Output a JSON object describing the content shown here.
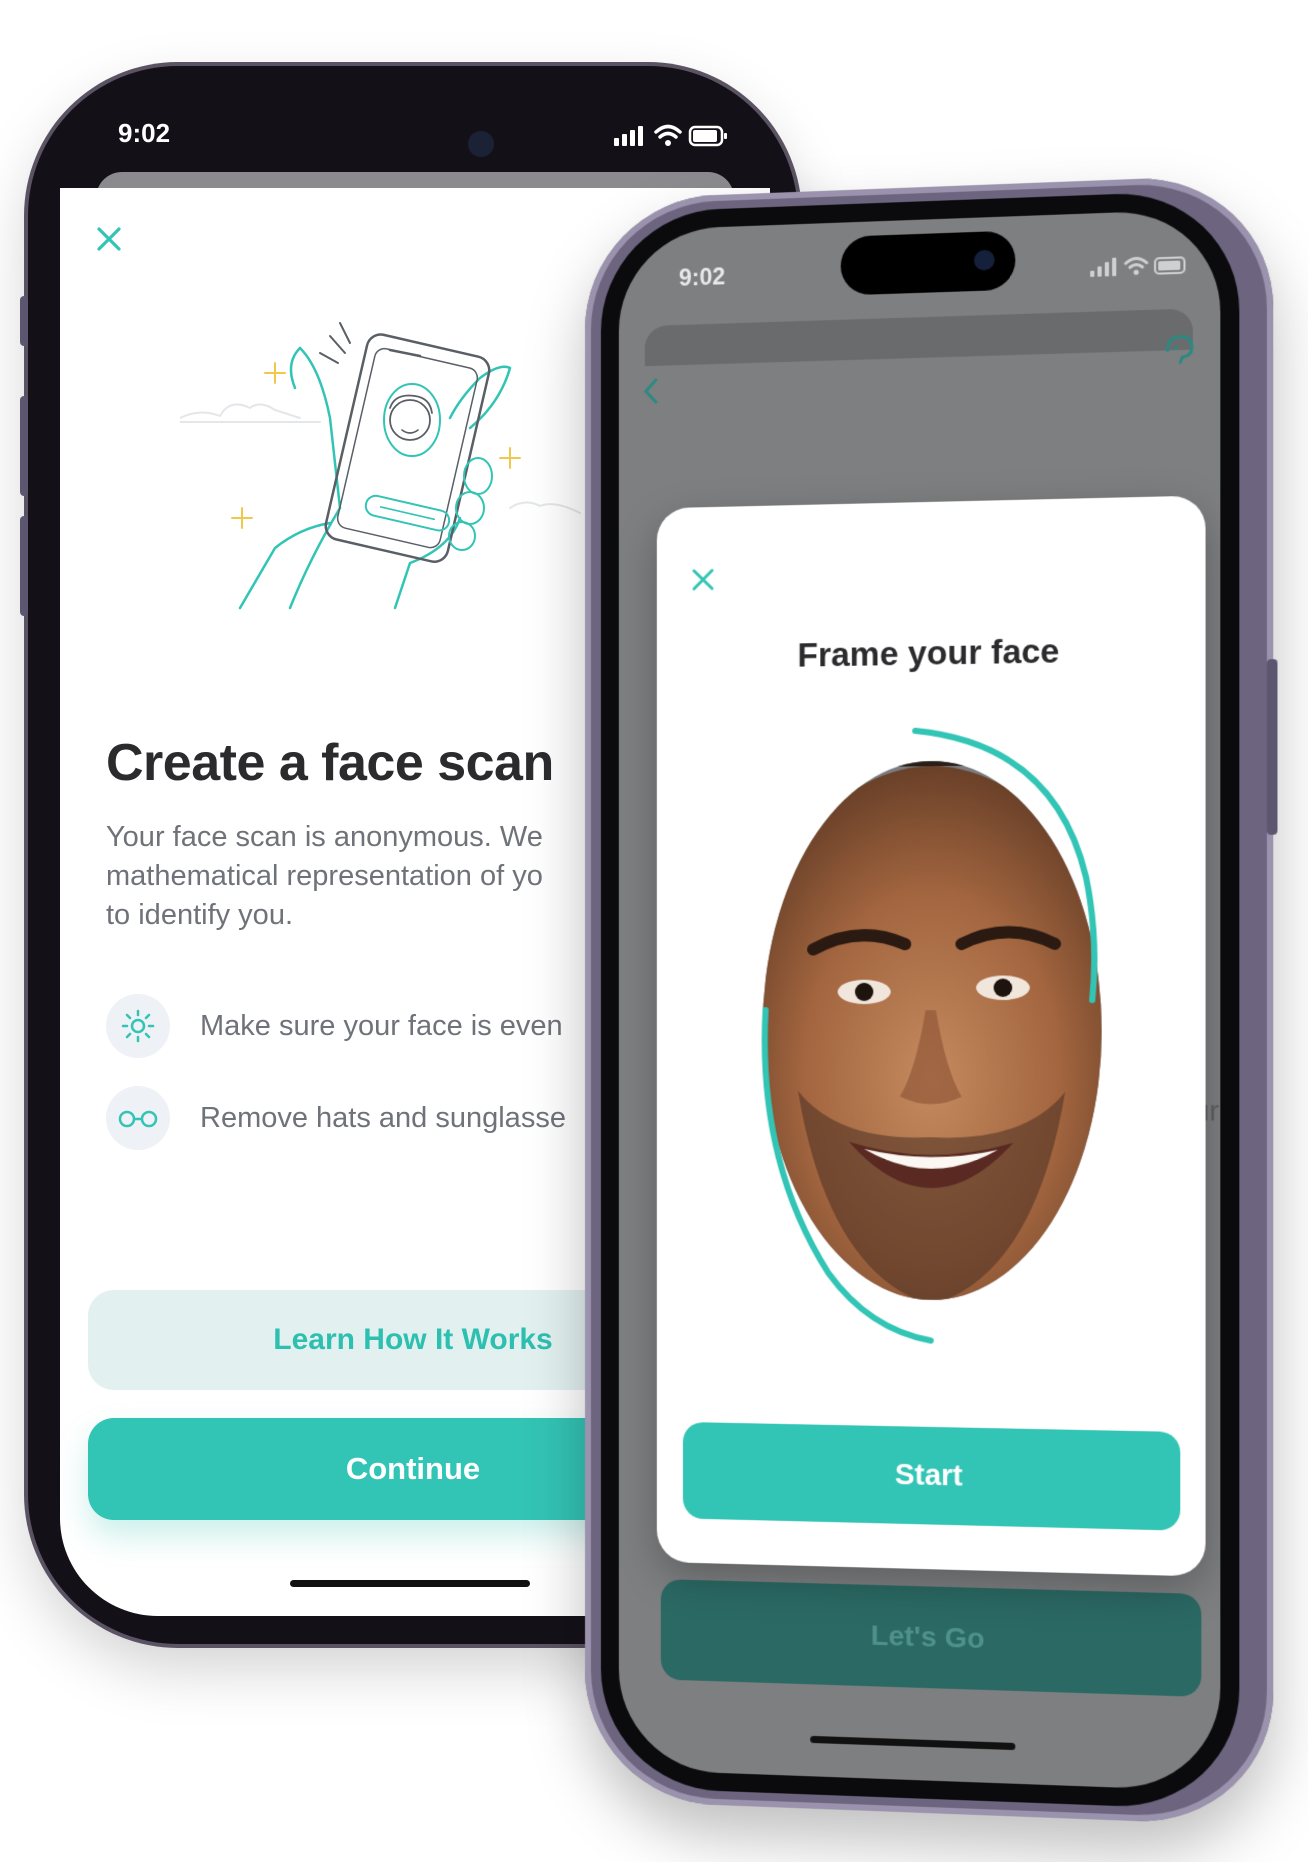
{
  "phone1": {
    "status": {
      "time": "9:02"
    },
    "title": "Create a face scan",
    "description_lines": [
      "Your face scan is anonymous. We",
      "mathematical representation of yo",
      "to identify you."
    ],
    "tips": [
      {
        "icon": "sun-icon",
        "text": "Make sure your face is even"
      },
      {
        "icon": "glasses-icon",
        "text": "Remove hats and sunglasse"
      }
    ],
    "learn_button": "Learn How It Works",
    "continue_button": "Continue"
  },
  "phone2": {
    "status": {
      "time": "9:02"
    },
    "modal_title": "Frame your face",
    "start_button": "Start",
    "background_button": "Let's Go",
    "background_partial_text": "ur"
  },
  "colors": {
    "accent": "#32c4b5",
    "accent_light": "#e2f1f0",
    "text_dark": "#2b2b2e",
    "text_muted": "#6f7379"
  }
}
